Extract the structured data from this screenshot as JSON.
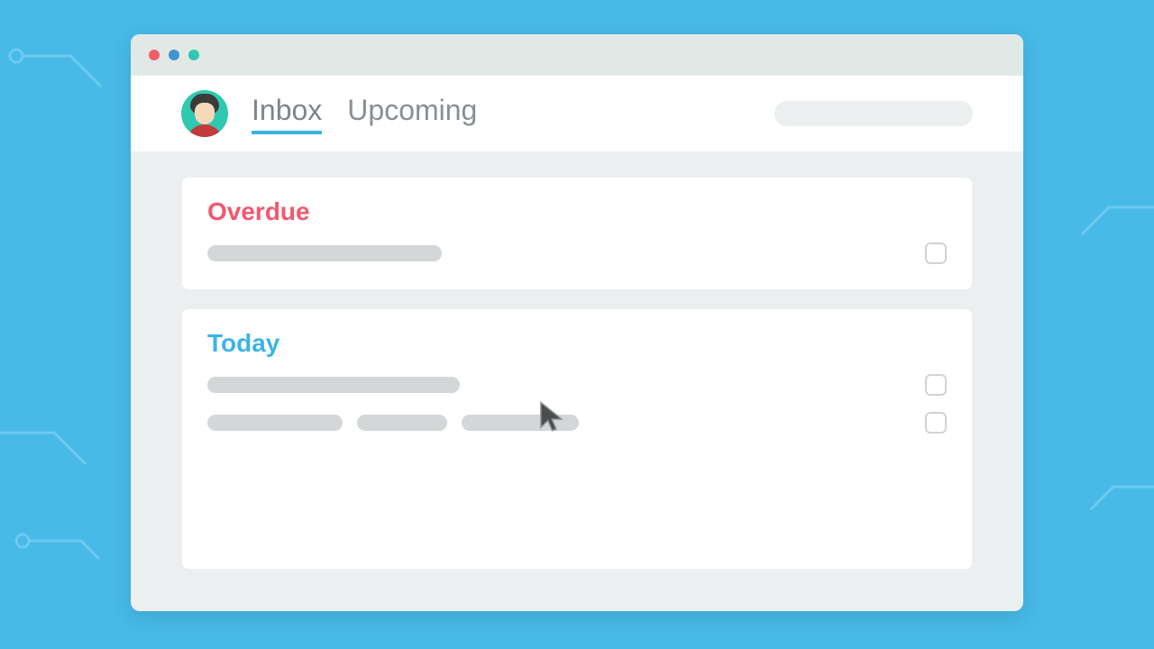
{
  "colors": {
    "background": "#47bae8",
    "accent": "#3cb4e6",
    "overdue": "#f2586e",
    "today": "#3cb4e6",
    "window_chrome": "#e1e9e7",
    "surface": "#ffffff",
    "muted": "#eceff0",
    "skeleton": "#d4d7d8"
  },
  "window": {
    "traffic_lights": [
      "close",
      "minimize",
      "zoom"
    ]
  },
  "header": {
    "tabs": [
      {
        "label": "Inbox",
        "active": true
      },
      {
        "label": "Upcoming",
        "active": false
      }
    ]
  },
  "sections": {
    "overdue": {
      "title": "Overdue",
      "tasks_count": 1
    },
    "today": {
      "title": "Today",
      "tasks_count": 2
    }
  }
}
